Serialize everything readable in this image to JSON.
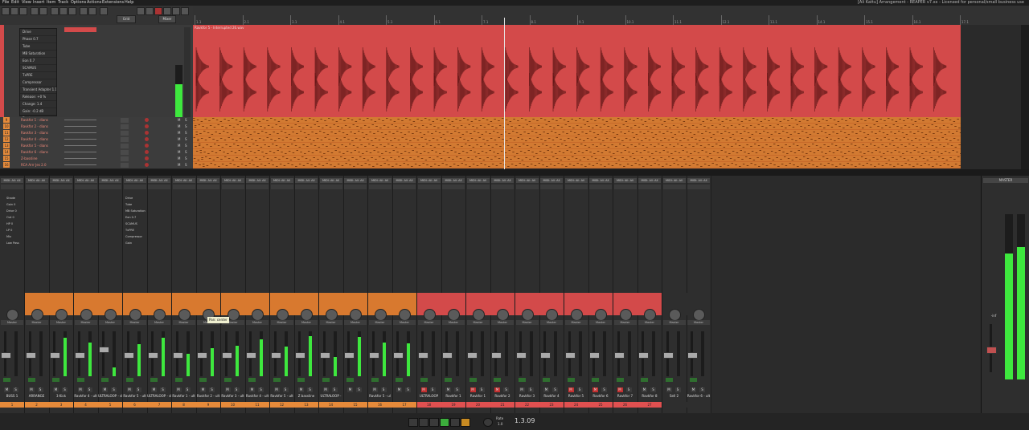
{
  "window_title": "[Ali Kattu] Arrangement - REAPER v7.xx - Licensed for personal/small business use",
  "menu": [
    "File",
    "Edit",
    "View",
    "Insert",
    "Item",
    "Track",
    "Options",
    "Actions",
    "Extensions",
    "Help"
  ],
  "toolbar_labels": {
    "grid_button": "Grid",
    "mixer_button": "Mixer"
  },
  "ruler_ticks": [
    "1.1",
    "2.1",
    "3.1",
    "4.1",
    "5.1",
    "6.1",
    "7.1",
    "8.1",
    "9.1",
    "10.1",
    "11.1",
    "12.1",
    "13.1",
    "14.1",
    "15.1",
    "16.1",
    "17.1"
  ],
  "drum_item_name": "Ravkfor 5 - Interrupted 26.wav",
  "drum_fx": [
    "Drive",
    "Phase 0.7",
    "Tube",
    "MB Saturation",
    "Eon 0.7",
    "SCAMUS",
    "TxPRE",
    "Compressor",
    "Transient Adapter 1.1",
    "Release: +0 %",
    "Change: 1.4",
    "Gain: -0.2 dB",
    "Dest"
  ],
  "tracks": [
    {
      "num": "9",
      "name": "Ravkfor 1 - dians"
    },
    {
      "num": "10",
      "name": "Ravkfor 2 - dians"
    },
    {
      "num": "11",
      "name": "Ravkfor 3 - dians"
    },
    {
      "num": "12",
      "name": "Ravkfor 4 - dians"
    },
    {
      "num": "13",
      "name": "Ravkfor 5 - dians"
    },
    {
      "num": "14",
      "name": "Ravkfor 6 - dians"
    },
    {
      "num": "15",
      "name": "Z-bassline"
    },
    {
      "num": "16",
      "name": "RCA Arrr Jes 2.0"
    }
  ],
  "mixer": {
    "io_label": "MIDI: All: All",
    "route_label": "Master",
    "tooltip": "Pan: center",
    "strips": [
      {
        "name": "BUSS 1",
        "num": "1",
        "color": "#2e2e2e",
        "meter": 0,
        "fader": 0.48,
        "mute": false
      },
      {
        "name": "ARRANGE",
        "num": "2",
        "color": "#d8792f",
        "meter": 0,
        "fader": 0.48,
        "mute": false
      },
      {
        "name": "3 Kick",
        "num": "3",
        "color": "#d8792f",
        "meter": 0.85,
        "fader": 0.48,
        "mute": false
      },
      {
        "name": "Ravkfor 4 - ult",
        "num": "4",
        "color": "#d8792f",
        "meter": 0.75,
        "fader": 0.48,
        "mute": false
      },
      {
        "name": "ULTRALOOP - sl",
        "num": "5",
        "color": "#d8792f",
        "meter": 0.2,
        "fader": 0.62,
        "mute": false
      },
      {
        "name": "Ravkfor 5 - ult",
        "num": "6",
        "color": "#d8792f",
        "meter": 0.72,
        "fader": 0.48,
        "mute": false
      },
      {
        "name": "ULTRALOOP - sl",
        "num": "7",
        "color": "#d8792f",
        "meter": 0.86,
        "fader": 0.48,
        "mute": false
      },
      {
        "name": "Ravkfor 1 - ult",
        "num": "8",
        "color": "#d8792f",
        "meter": 0.5,
        "fader": 0.48,
        "mute": false
      },
      {
        "name": "Ravkfor 2 - ult",
        "num": "9",
        "color": "#d8792f",
        "meter": 0.62,
        "fader": 0.48,
        "mute": false
      },
      {
        "name": "Ravkfor 3 - ult",
        "num": "10",
        "color": "#d8792f",
        "meter": 0.68,
        "fader": 0.48,
        "mute": false
      },
      {
        "name": "Ravkfor 4 - ult",
        "num": "11",
        "color": "#d8792f",
        "meter": 0.82,
        "fader": 0.48,
        "mute": false
      },
      {
        "name": "Ravkfor 5 - ult",
        "num": "12",
        "color": "#d8792f",
        "meter": 0.66,
        "fader": 0.48,
        "mute": false
      },
      {
        "name": "Z bassline",
        "num": "13",
        "color": "#d8792f",
        "meter": 0.9,
        "fader": 0.48,
        "mute": false
      },
      {
        "name": "ULTRALOOP -",
        "num": "14",
        "color": "#d8792f",
        "meter": 0.42,
        "fader": 0.48,
        "mute": false
      },
      {
        "name": "",
        "num": "15",
        "color": "#d8792f",
        "meter": 0.88,
        "fader": 0.48,
        "mute": false
      },
      {
        "name": "Ravkfor 5 - ul",
        "num": "16",
        "color": "#d8792f",
        "meter": 0.75,
        "fader": 0.48,
        "mute": false
      },
      {
        "name": "",
        "num": "17",
        "color": "#d8792f",
        "meter": 0.74,
        "fader": 0.48,
        "mute": false
      },
      {
        "name": "ULTRALOOP",
        "num": "18",
        "color": "#d34a4a",
        "meter": 0,
        "fader": 0.48,
        "mute": true
      },
      {
        "name": "Ravkfor 1",
        "num": "19",
        "color": "#d34a4a",
        "meter": 0,
        "fader": 0.48,
        "mute": false
      },
      {
        "name": "Ravkfor 1",
        "num": "20",
        "color": "#d34a4a",
        "meter": 0,
        "fader": 0.48,
        "mute": true
      },
      {
        "name": "Ravkfor 2",
        "num": "21",
        "color": "#d34a4a",
        "meter": 0,
        "fader": 0.48,
        "mute": true
      },
      {
        "name": "Ravkfor 3",
        "num": "22",
        "color": "#d34a4a",
        "meter": 0,
        "fader": 0.48,
        "mute": false
      },
      {
        "name": "Ravkfor 4",
        "num": "23",
        "color": "#d34a4a",
        "meter": 0,
        "fader": 0.48,
        "mute": false
      },
      {
        "name": "Ravkfor 5",
        "num": "24",
        "color": "#d34a4a",
        "meter": 0,
        "fader": 0.48,
        "mute": true
      },
      {
        "name": "Ravkfor 6",
        "num": "25",
        "color": "#d34a4a",
        "meter": 0,
        "fader": 0.48,
        "mute": true
      },
      {
        "name": "Ravkfor 7",
        "num": "26",
        "color": "#d34a4a",
        "meter": 0,
        "fader": 0.48,
        "mute": true
      },
      {
        "name": "Ravkfor 8",
        "num": "27",
        "color": "#d34a4a",
        "meter": 0,
        "fader": 0.48,
        "mute": false
      },
      {
        "name": "Sell 2",
        "num": "",
        "color": "#2e2e2e",
        "meter": 0,
        "fader": 0.48,
        "mute": false
      },
      {
        "name": "Ravkfor 6 - ult",
        "num": "",
        "color": "#2e2e2e",
        "meter": 0,
        "fader": 0.48,
        "mute": false
      }
    ],
    "fx_panels": [
      {
        "title": "Shade",
        "items": [
          "Gain 0",
          "Drive 0",
          "Out 0",
          "HP 0",
          "LP 0",
          "Mix",
          "Low Pass"
        ]
      },
      {
        "title": "Drive",
        "items": [
          "Tube",
          "MB Saturation",
          "Eon 0.7",
          "SCAMUS",
          "TxPRE",
          "Compressor",
          "Gain"
        ]
      }
    ]
  },
  "master": {
    "label": "MASTER",
    "meterL": 0.76,
    "meterR": 0.8,
    "volume": "-inf"
  },
  "transport": {
    "time": "1.3.09",
    "rate_label": "Rate",
    "rate_value": "1.0"
  }
}
